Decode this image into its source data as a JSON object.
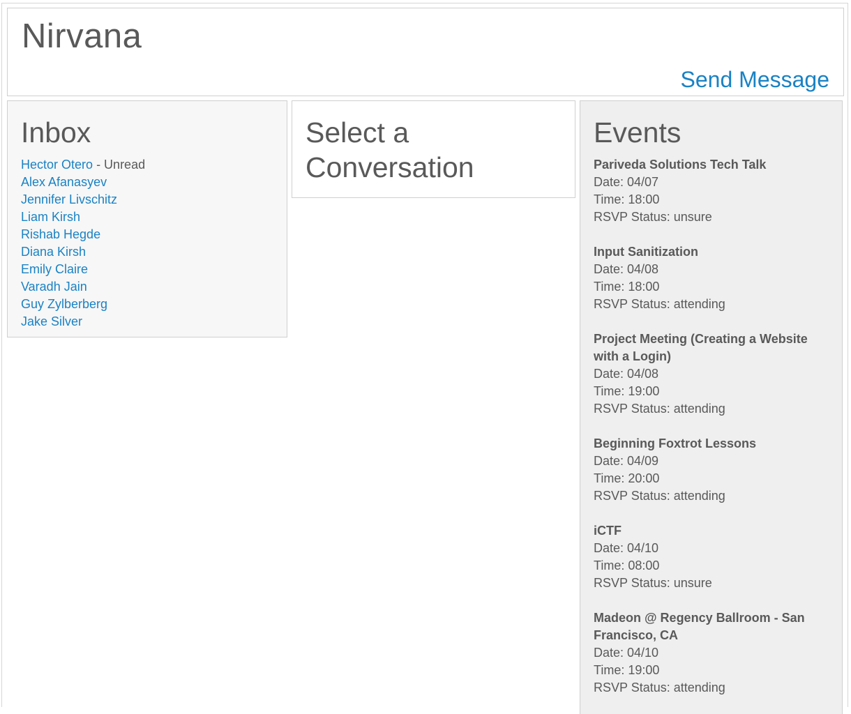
{
  "header": {
    "title": "Nirvana",
    "send_message": "Send Message"
  },
  "inbox": {
    "title": "Inbox",
    "unread_label": "- Unread",
    "contacts": [
      {
        "name": "Hector Otero",
        "unread": true
      },
      {
        "name": "Alex Afanasyev",
        "unread": false
      },
      {
        "name": "Jennifer Livschitz",
        "unread": false
      },
      {
        "name": "Liam Kirsh",
        "unread": false
      },
      {
        "name": "Rishab Hegde",
        "unread": false
      },
      {
        "name": "Diana Kirsh",
        "unread": false
      },
      {
        "name": "Emily Claire",
        "unread": false
      },
      {
        "name": "Varadh Jain",
        "unread": false
      },
      {
        "name": "Guy Zylberberg",
        "unread": false
      },
      {
        "name": "Jake Silver",
        "unread": false
      }
    ]
  },
  "conversation": {
    "title": "Select a Conversation"
  },
  "events": {
    "title": "Events",
    "items": [
      {
        "name": "Pariveda Solutions Tech Talk",
        "date": "Date: 04/07",
        "time": "Time: 18:00",
        "rsvp": "RSVP Status: unsure"
      },
      {
        "name": "Input Sanitization",
        "date": "Date: 04/08",
        "time": "Time: 18:00",
        "rsvp": "RSVP Status: attending"
      },
      {
        "name": "Project Meeting (Creating a Website with a Login)",
        "date": "Date: 04/08",
        "time": "Time: 19:00",
        "rsvp": "RSVP Status: attending"
      },
      {
        "name": "Beginning Foxtrot Lessons",
        "date": "Date: 04/09",
        "time": "Time: 20:00",
        "rsvp": "RSVP Status: attending"
      },
      {
        "name": "iCTF",
        "date": "Date: 04/10",
        "time": "Time: 08:00",
        "rsvp": "RSVP Status: unsure"
      },
      {
        "name": "Madeon @ Regency Ballroom - San Francisco, CA",
        "date": "Date: 04/10",
        "time": "Time: 19:00",
        "rsvp": "RSVP Status: attending"
      }
    ]
  },
  "colors": {
    "link": "#1a82c4",
    "text": "#595959",
    "inbox_bg": "#f7f7f7",
    "events_bg": "#efefef",
    "border": "#cfcfcf"
  }
}
